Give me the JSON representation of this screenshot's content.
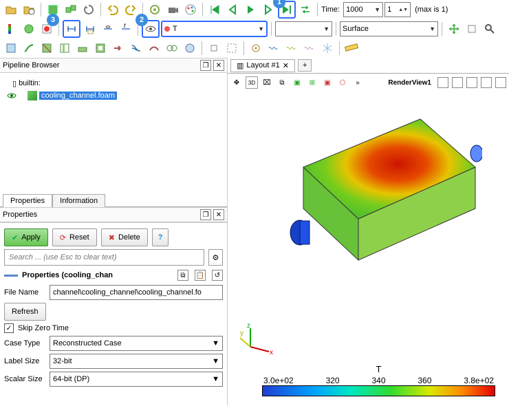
{
  "time": {
    "label": "Time:",
    "value": "1000",
    "frame": "1",
    "max": "(max is 1)"
  },
  "field_combo": "T",
  "repr_combo": "Surface",
  "pipeline": {
    "title": "Pipeline Browser",
    "root": "builtin:",
    "file": "cooling_channel.foam"
  },
  "tabs": {
    "props": "Properties",
    "info": "Information"
  },
  "props": {
    "title": "Properties",
    "apply": "Apply",
    "reset": "Reset",
    "delete": "Delete",
    "search_ph": "Search ... (use Esc to clear text)",
    "section": "Properties (cooling_chan",
    "file_label": "File Name",
    "file_value": "channel\\cooling_channel\\cooling_channel.fo",
    "refresh": "Refresh",
    "skip": "Skip Zero Time",
    "case_label": "Case Type",
    "case_value": "Reconstructed Case",
    "label_label": "Label Size",
    "label_value": "32-bit",
    "scalar_label": "Scalar Size",
    "scalar_value": "64-bit (DP)"
  },
  "layout": {
    "tab": "Layout #1",
    "mode": "3D",
    "render": "RenderView1"
  },
  "legend": {
    "title": "T",
    "t0": "3.0e+02",
    "t1": "320",
    "t2": "340",
    "t3": "360",
    "t4": "3.8e+02"
  },
  "axis": {
    "x": "x",
    "y": "y",
    "z": "z"
  },
  "badges": {
    "b1": "1",
    "b2": "2",
    "b3": "3"
  },
  "chart_data": {
    "type": "heatmap",
    "title": "T",
    "colormap": "rainbow",
    "range": [
      300,
      380
    ],
    "ticks": [
      300,
      320,
      340,
      360,
      380
    ]
  }
}
